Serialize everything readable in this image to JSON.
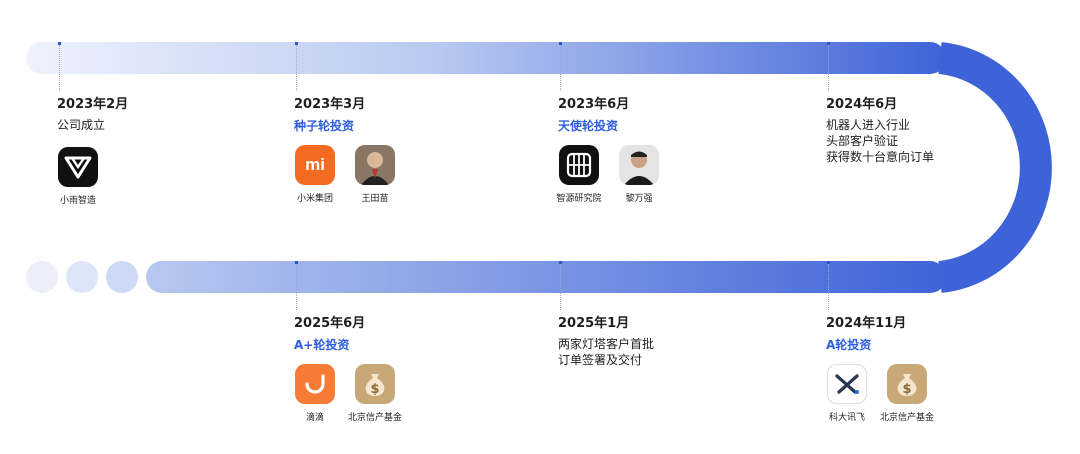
{
  "track_colors": {
    "light": "#eef2fc",
    "mid": "#b8c8f0",
    "deep": "#3e63d8",
    "circle_1": "#eceff9",
    "circle_2": "#dde6f8",
    "circle_3": "#cdd9f5"
  },
  "milestones": [
    {
      "date": "2023年2月",
      "round": "",
      "desc": [
        "公司成立"
      ],
      "logos": [
        {
          "name": "小雨智造",
          "icon": "xiaoyu-logo-icon"
        }
      ]
    },
    {
      "date": "2023年3月",
      "round": "种子轮投资",
      "desc": [],
      "logos": [
        {
          "name": "小米集团",
          "icon": "xiaomi-logo-icon",
          "mark": "mi"
        },
        {
          "name": "王田苗",
          "icon": "investor-portrait-icon"
        }
      ]
    },
    {
      "date": "2023年6月",
      "round": "天使轮投资",
      "desc": [],
      "logos": [
        {
          "name": "智源研究院",
          "icon": "baai-logo-icon"
        },
        {
          "name": "黎万强",
          "icon": "investor-portrait-icon"
        }
      ]
    },
    {
      "date": "2024年6月",
      "round": "",
      "desc": [
        "机器人进入行业",
        "头部客户验证",
        "获得数十台意向订单"
      ],
      "logos": []
    },
    {
      "date": "2025年6月",
      "round": "A+轮投资",
      "desc": [],
      "logos": [
        {
          "name": "滴滴",
          "icon": "didi-logo-icon"
        },
        {
          "name": "北京信产基金",
          "icon": "money-bag-icon",
          "mark": "$"
        }
      ]
    },
    {
      "date": "2025年1月",
      "round": "",
      "desc": [
        "两家灯塔客户首批",
        "订单签署及交付"
      ],
      "logos": []
    },
    {
      "date": "2024年11月",
      "round": "A轮投资",
      "desc": [],
      "logos": [
        {
          "name": "科大讯飞",
          "icon": "iflytek-logo-icon"
        },
        {
          "name": "北京信产基金",
          "icon": "money-bag-icon",
          "mark": "$"
        }
      ]
    }
  ]
}
